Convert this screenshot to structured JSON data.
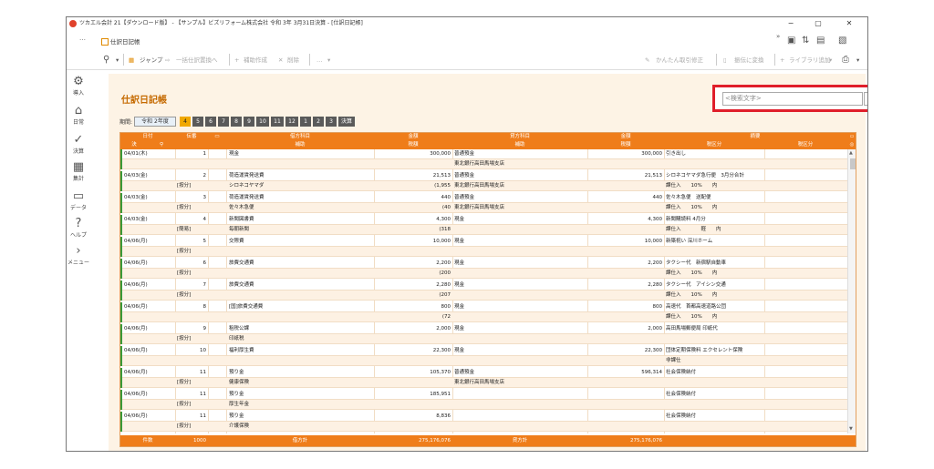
{
  "window": {
    "title": "ツカエル会計 21【ダウンロード版】 - 【サンプル】ビズリフォーム株式会社 令和 3年 3月31日決算 - [仕訳日記帳]",
    "minimize": "−",
    "maximize": "▢",
    "close": "✕"
  },
  "tabbar": {
    "dots": "…",
    "tab_label": "仕訳日記帳",
    "chevrons": "»"
  },
  "toolbar": {
    "jump": "ジャンプ",
    "bulk_replace": "一括仕訳置換へ",
    "sub_create": "補助作成",
    "delete": "削除",
    "more": "…",
    "easy_fix": "かんたん取引修正",
    "to_receipt": "振伝に変換",
    "library_add": "ライブラリ追加",
    "more_dd": "▾"
  },
  "sidebar": {
    "items": [
      {
        "label": "導入",
        "icon": "gear-icon",
        "glyph": "⚙"
      },
      {
        "label": "日常",
        "icon": "home-icon",
        "glyph": "⌂"
      },
      {
        "label": "決算",
        "icon": "check-icon",
        "glyph": "✓"
      },
      {
        "label": "集計",
        "icon": "calculator-icon",
        "glyph": "▦"
      },
      {
        "label": "データ",
        "icon": "folder-icon",
        "glyph": "▭"
      },
      {
        "label": "ヘルプ",
        "icon": "help-icon",
        "glyph": "?"
      },
      {
        "label": "メニュー",
        "icon": "chevron-right-icon",
        "glyph": "›"
      }
    ]
  },
  "page": {
    "title": "仕訳日記帳",
    "period_label": "期間:",
    "fiscal_year": "令和 2年度",
    "months": [
      "4",
      "5",
      "6",
      "7",
      "8",
      "9",
      "10",
      "11",
      "12",
      "1",
      "2",
      "3",
      "決算"
    ],
    "active_month": "4"
  },
  "search": {
    "placeholder": "<検索文字>",
    "search_icon": "⚲",
    "clear_icon": "⊖"
  },
  "table": {
    "headers_top": [
      "日付",
      "伝番",
      "",
      "借方科目",
      "金額",
      "貸方科目",
      "金額",
      "摘要"
    ],
    "headers_bottom": [
      "決",
      "",
      "",
      "補助",
      "税額",
      "補助",
      "税額",
      "税区分",
      "税区分"
    ],
    "rows": [
      {
        "date": "04/01(木)",
        "no": "1",
        "dr": "現金",
        "dr_amt": "300,000",
        "cr": "普通預金",
        "cr_amt": "300,000",
        "memo": "引き出し",
        "sub_dr": "",
        "sub_dr_tax": "",
        "sub_cr": "東北銀行高田馬場支店",
        "sub_cr_tax": "",
        "sub_memo": "",
        "tag": ""
      },
      {
        "date": "04/03(金)",
        "no": "2",
        "dr": "荷造運賃発送費",
        "dr_amt": "21,513",
        "cr": "普通預金",
        "cr_amt": "21,513",
        "memo": "シロネコヤマダ急行便　3月分合計",
        "sub_dr": "シロネコヤマダ",
        "sub_dr_tax": "(1,955",
        "sub_cr": "東北銀行高田馬場支店",
        "sub_cr_tax": "",
        "sub_memo": "課仕入　　10%　　内",
        "tag": "[按分]"
      },
      {
        "date": "04/03(金)",
        "no": "3",
        "dr": "荷造運賃発送費",
        "dr_amt": "440",
        "cr": "普通預金",
        "cr_amt": "440",
        "memo": "佐々木急便　送配便",
        "sub_dr": "佐々木急便",
        "sub_dr_tax": "(40",
        "sub_cr": "東北銀行高田馬場支店",
        "sub_cr_tax": "",
        "sub_memo": "課仕入　　10%　　内",
        "tag": "[按分]"
      },
      {
        "date": "04/03(金)",
        "no": "4",
        "dr": "新聞図書費",
        "dr_amt": "4,300",
        "cr": "現金",
        "cr_amt": "4,300",
        "memo": "新聞購読料 4月分",
        "sub_dr": "毎朝新聞",
        "sub_dr_tax": "(318",
        "sub_cr": "",
        "sub_cr_tax": "",
        "sub_memo": "課仕入　　　　軽　　内",
        "tag": "[簡易]"
      },
      {
        "date": "04/06(月)",
        "no": "5",
        "dr": "交際費",
        "dr_amt": "10,000",
        "cr": "現金",
        "cr_amt": "10,000",
        "memo": "新築祝い 深川ホーム",
        "sub_dr": "",
        "sub_dr_tax": "",
        "sub_cr": "",
        "sub_cr_tax": "",
        "sub_memo": "",
        "tag": "[按分]"
      },
      {
        "date": "04/06(月)",
        "no": "6",
        "dr": "旅費交通費",
        "dr_amt": "2,200",
        "cr": "現金",
        "cr_amt": "2,200",
        "memo": "タクシー代　新宿駅自動車",
        "sub_dr": "",
        "sub_dr_tax": "(200",
        "sub_cr": "",
        "sub_cr_tax": "",
        "sub_memo": "課仕入　　10%　　内",
        "tag": "[按分]"
      },
      {
        "date": "04/06(月)",
        "no": "7",
        "dr": "旅費交通費",
        "dr_amt": "2,280",
        "cr": "現金",
        "cr_amt": "2,280",
        "memo": "タクシー代　アイシン交通",
        "sub_dr": "",
        "sub_dr_tax": "(207",
        "sub_cr": "",
        "sub_cr_tax": "",
        "sub_memo": "課仕入　　10%　　内",
        "tag": "[按分]"
      },
      {
        "date": "04/06(月)",
        "no": "8",
        "dr": "[国]旅費交通費",
        "dr_amt": "800",
        "cr": "現金",
        "cr_amt": "800",
        "memo": "高速代　首都高速道路公団",
        "sub_dr": "",
        "sub_dr_tax": "(72",
        "sub_cr": "",
        "sub_cr_tax": "",
        "sub_memo": "課仕入　　10%　　内",
        "tag": ""
      },
      {
        "date": "04/06(月)",
        "no": "9",
        "dr": "租税公課",
        "dr_amt": "2,000",
        "cr": "現金",
        "cr_amt": "2,000",
        "memo": "高田馬場郵便局 印紙代",
        "sub_dr": "印紙税",
        "sub_dr_tax": "",
        "sub_cr": "",
        "sub_cr_tax": "",
        "sub_memo": "",
        "tag": "[按分]"
      },
      {
        "date": "04/06(月)",
        "no": "10",
        "dr": "福利厚生費",
        "dr_amt": "22,300",
        "cr": "現金",
        "cr_amt": "22,300",
        "memo": "団体定期保険料 エクセレント保険",
        "sub_dr": "",
        "sub_dr_tax": "",
        "sub_cr": "",
        "sub_cr_tax": "",
        "sub_memo": "非課仕",
        "tag": ""
      },
      {
        "date": "04/06(月)",
        "no": "11",
        "dr": "預り金",
        "dr_amt": "105,370",
        "cr": "普通預金",
        "cr_amt": "596,314",
        "memo": "社会保険納付",
        "sub_dr": "健康保険",
        "sub_dr_tax": "",
        "sub_cr": "東北銀行高田馬場支店",
        "sub_cr_tax": "",
        "sub_memo": "",
        "tag": "[按分]"
      },
      {
        "date": "04/06(月)",
        "no": "11",
        "dr": "預り金",
        "dr_amt": "185,951",
        "cr": "",
        "cr_amt": "",
        "memo": "社会保険納付",
        "sub_dr": "厚生年金",
        "sub_dr_tax": "",
        "sub_cr": "",
        "sub_cr_tax": "",
        "sub_memo": "",
        "tag": "[按分]"
      },
      {
        "date": "04/06(月)",
        "no": "11",
        "dr": "預り金",
        "dr_amt": "8,836",
        "cr": "",
        "cr_amt": "",
        "memo": "社会保険納付",
        "sub_dr": "介護保険",
        "sub_dr_tax": "",
        "sub_cr": "",
        "sub_cr_tax": "",
        "sub_memo": "",
        "tag": "[按分]"
      }
    ],
    "footer": {
      "count_label": "件数",
      "count": "1000",
      "dr_total_label": "借方計",
      "dr_total": "275,176,076",
      "cr_total_label": "貸方計",
      "cr_total": "275,176,076"
    }
  },
  "colors": {
    "accent": "#ef7d1a",
    "highlight": "#e01e2a",
    "active_month": "#f0a800",
    "row_marker": "#3a9a3a"
  }
}
